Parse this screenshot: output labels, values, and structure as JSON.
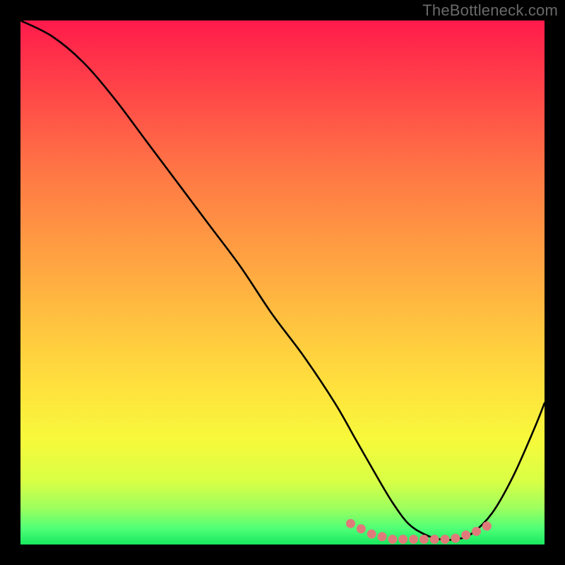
{
  "attribution": "TheBottleneck.com",
  "chart_data": {
    "type": "line",
    "title": "",
    "xlabel": "",
    "ylabel": "",
    "xlim": [
      0,
      100
    ],
    "ylim": [
      0,
      100
    ],
    "series": [
      {
        "name": "curve",
        "x": [
          0,
          6,
          12,
          18,
          24,
          30,
          36,
          42,
          48,
          54,
          60,
          64,
          68,
          71,
          74,
          77,
          80,
          83,
          86,
          90,
          94,
          98,
          100
        ],
        "y": [
          100,
          97,
          92,
          85,
          77,
          69,
          61,
          53,
          44,
          36,
          27,
          20,
          13,
          8,
          4,
          2,
          1,
          1,
          2,
          6,
          13,
          22,
          27
        ]
      }
    ],
    "markers": {
      "name": "threshold-dots",
      "color": "#e07a7a",
      "x": [
        63,
        65,
        67,
        69,
        71,
        73,
        75,
        77,
        79,
        81,
        83,
        85,
        87,
        89
      ],
      "y": [
        4,
        3,
        2,
        1.5,
        1,
        1,
        1,
        1,
        1,
        1,
        1.2,
        1.8,
        2.5,
        3.5
      ]
    },
    "gradient_stops": [
      {
        "pos": 0,
        "color": "#ff1a4b"
      },
      {
        "pos": 50,
        "color": "#ffae41"
      },
      {
        "pos": 80,
        "color": "#f7f93b"
      },
      {
        "pos": 100,
        "color": "#18e85e"
      }
    ]
  }
}
